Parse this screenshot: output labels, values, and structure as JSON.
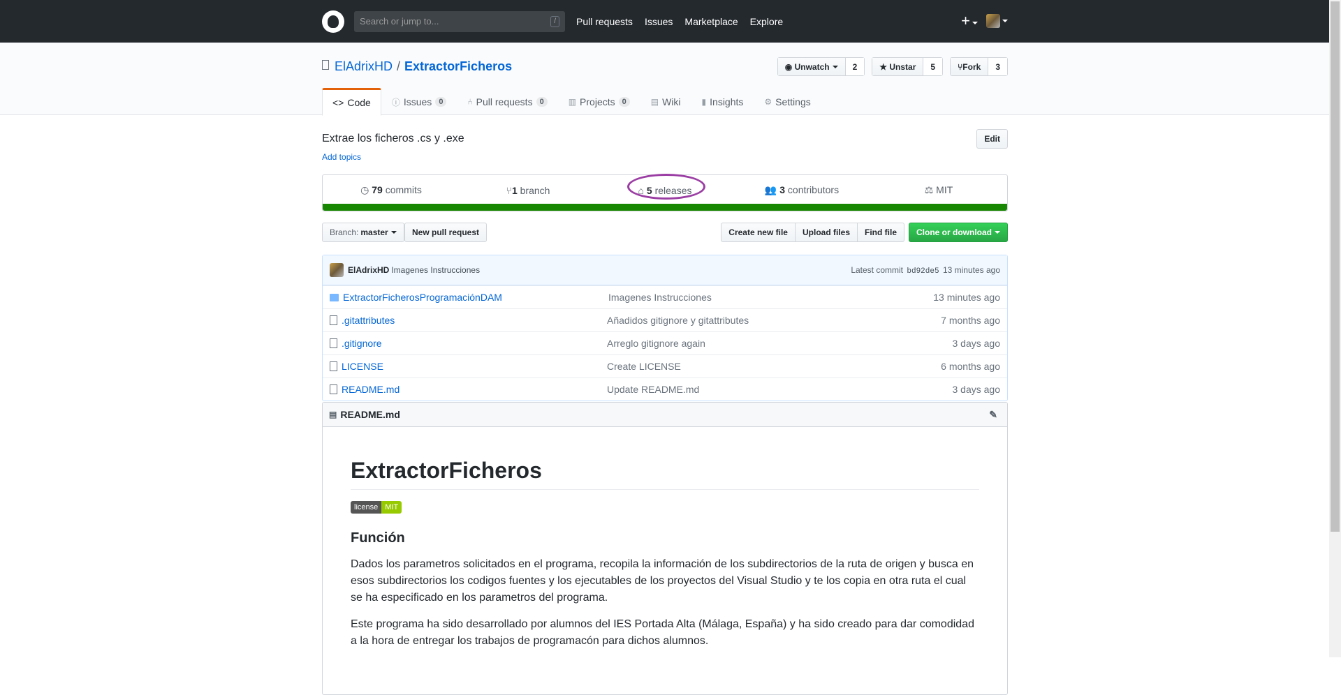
{
  "header": {
    "search_placeholder": "Search or jump to...",
    "search_shortcut": "/",
    "nav": [
      "Pull requests",
      "Issues",
      "Marketplace",
      "Explore"
    ],
    "new_icon": "+"
  },
  "repo": {
    "owner": "ElAdrixHD",
    "separator": "/",
    "name": "ExtractorFicheros",
    "watch": {
      "label": "Unwatch",
      "count": "2"
    },
    "star": {
      "label": "Unstar",
      "count": "5"
    },
    "fork": {
      "label": "Fork",
      "count": "3"
    }
  },
  "tabs": [
    {
      "label": "Code",
      "icon": "<>",
      "count": ""
    },
    {
      "label": "Issues",
      "icon": "ⓘ",
      "count": "0"
    },
    {
      "label": "Pull requests",
      "icon": "⑃",
      "count": "0"
    },
    {
      "label": "Projects",
      "icon": "▥",
      "count": "0"
    },
    {
      "label": "Wiki",
      "icon": "▤",
      "count": ""
    },
    {
      "label": "Insights",
      "icon": "▮",
      "count": ""
    },
    {
      "label": "Settings",
      "icon": "⚙",
      "count": ""
    }
  ],
  "description": {
    "text": "Extrae los ficheros .cs y .exe",
    "topics_link": "Add topics",
    "edit_label": "Edit"
  },
  "summary": {
    "commits_count": "79",
    "commits_label": "commits",
    "branch_count": "1",
    "branch_label": "branch",
    "releases_count": "5",
    "releases_label": "releases",
    "contributors_count": "3",
    "contributors_label": "contributors",
    "license": "MIT",
    "language_color": "#178600"
  },
  "filebar": {
    "branch_prefix": "Branch:",
    "branch_name": "master",
    "new_pr": "New pull request",
    "create_file": "Create new file",
    "upload_files": "Upload files",
    "find_file": "Find file",
    "clone": "Clone or download"
  },
  "latest_commit": {
    "author": "ElAdrixHD",
    "message": "Imagenes Instrucciones",
    "label": "Latest commit",
    "sha": "bd92de5",
    "age": "13 minutes ago"
  },
  "files": [
    {
      "name": "ExtractorFicherosProgramaciónDAM",
      "type": "folder",
      "message": "Imagenes Instrucciones",
      "age": "13 minutes ago"
    },
    {
      "name": ".gitattributes",
      "type": "file",
      "message": "Añadidos gitignore y gitattributes",
      "age": "7 months ago"
    },
    {
      "name": ".gitignore",
      "type": "file",
      "message": "Arreglo gitignore again",
      "age": "3 days ago"
    },
    {
      "name": "LICENSE",
      "type": "file",
      "message": "Create LICENSE",
      "age": "6 months ago"
    },
    {
      "name": "README.md",
      "type": "file",
      "message": "Update README.md",
      "age": "3 days ago"
    }
  ],
  "readme": {
    "filename": "README.md",
    "title": "ExtractorFicheros",
    "badge_left": "license",
    "badge_right": "MIT",
    "section": "Función",
    "p1": "Dados los parametros solicitados en el programa, recopila la información de los subdirectorios de la ruta de origen y busca en esos subdirectorios los codigos fuentes y los ejecutables de los proyectos del Visual Studio y te los copia en otra ruta el cual se ha especificado en los parametros del programa.",
    "p2": "Este programa ha sido desarrollado por alumnos del IES Portada Alta (Málaga, España) y ha sido creado para dar comodidad a la hora de entregar los trabajos de programacón para dichos alumnos."
  }
}
